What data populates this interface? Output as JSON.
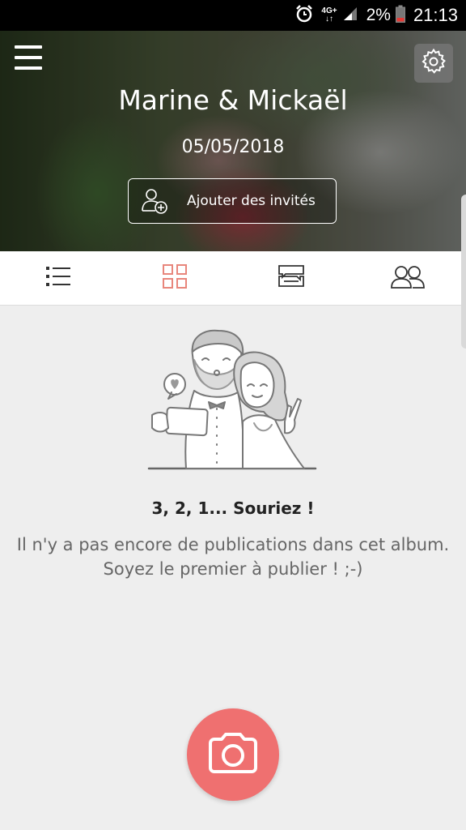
{
  "status_bar": {
    "network_top": "4G+",
    "network_bottom": "↓↑",
    "battery_percent": "2%",
    "time": "21:13",
    "icons": [
      "alarm-icon",
      "signal-icon",
      "battery-low-icon"
    ]
  },
  "header": {
    "title": "Marine & Mickaël",
    "date": "05/05/2018",
    "add_guests_label": "Ajouter des invités",
    "icons": [
      "menu-icon",
      "gear-icon",
      "add-user-icon"
    ]
  },
  "tabs": [
    {
      "name": "list",
      "icon": "list-icon",
      "active": false
    },
    {
      "name": "grid",
      "icon": "grid-icon",
      "active": true
    },
    {
      "name": "messages",
      "icon": "chat-bubbles-icon",
      "active": false
    },
    {
      "name": "guests",
      "icon": "people-icon",
      "active": false
    }
  ],
  "empty_state": {
    "title": "3, 2, 1... Souriez !",
    "message": "Il n'y a pas encore de publications dans cet album. Soyez le premier à publier ! ;-)"
  },
  "fab": {
    "icon": "camera-icon"
  },
  "colors": {
    "accent": "#ef7070",
    "active_tab_icon": "#e8867c",
    "inactive_tab_icon": "#333333",
    "background": "#eeeeee"
  }
}
